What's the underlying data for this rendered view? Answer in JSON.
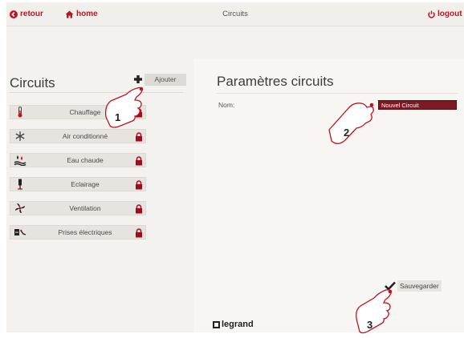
{
  "topbar": {
    "back_label": "retour",
    "home_label": "home",
    "title": "Circuits",
    "logout_label": "logout"
  },
  "left_panel": {
    "heading": "Circuits",
    "add_label": "Ajouter",
    "items": [
      {
        "label": "Chauffage",
        "icon": "thermometer-icon",
        "locked": true
      },
      {
        "label": "Air conditionné",
        "icon": "snowflake-icon",
        "locked": true
      },
      {
        "label": "Eau chaude",
        "icon": "water-drop-icon",
        "locked": true
      },
      {
        "label": "Eclairage",
        "icon": "lamp-icon",
        "locked": true
      },
      {
        "label": "Ventilation",
        "icon": "fan-icon",
        "locked": true
      },
      {
        "label": "Prises électriques",
        "icon": "plug-icon",
        "locked": true
      }
    ]
  },
  "right_panel": {
    "heading": "Paramètres circuits",
    "name_label": "Nom:",
    "name_value": "Nouvel Circuit",
    "save_label": "Sauvegarder",
    "brand": "legrand"
  },
  "callouts": [
    {
      "number": "1",
      "target": "Ajouter"
    },
    {
      "number": "2",
      "target": "Nom"
    },
    {
      "number": "3",
      "target": "Sauvegarder"
    }
  ],
  "colors": {
    "accent_red": "#c1121f",
    "input_bg": "#7d1a24",
    "panel_bg": "#f4f2ee"
  }
}
